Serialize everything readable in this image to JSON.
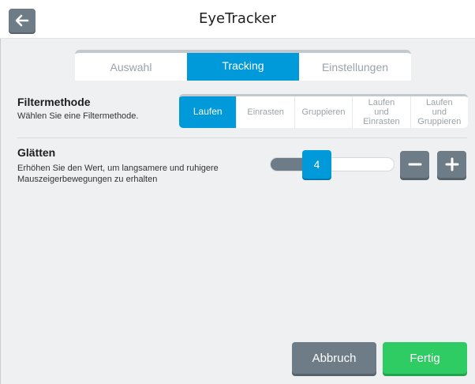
{
  "app": {
    "title": "EyeTracker"
  },
  "tabs": [
    {
      "label": "Auswahl",
      "active": false
    },
    {
      "label": "Tracking",
      "active": true
    },
    {
      "label": "Einstellungen",
      "active": false
    }
  ],
  "filter": {
    "title": "Filtermethode",
    "description": "Wählen Sie eine Filtermethode.",
    "options": [
      {
        "label": "Laufen",
        "active": true
      },
      {
        "label": "Einrasten",
        "active": false
      },
      {
        "label": "Gruppieren",
        "active": false
      },
      {
        "label": "Laufen\nund\nEinrasten",
        "active": false
      },
      {
        "label": "Laufen\nund\nGruppieren",
        "active": false
      }
    ]
  },
  "smoothing": {
    "title": "Glätten",
    "description": "Erhöhen Sie den Wert, um langsamere und ruhigere Mauszeigerbewegungen zu erhalten",
    "value": "4",
    "fraction": 0.33
  },
  "footer": {
    "cancel_label": "Abbruch",
    "done_label": "Fertig"
  },
  "colors": {
    "accent": "#0099d9",
    "neutral": "#6d7c86",
    "success": "#2ecc63"
  }
}
